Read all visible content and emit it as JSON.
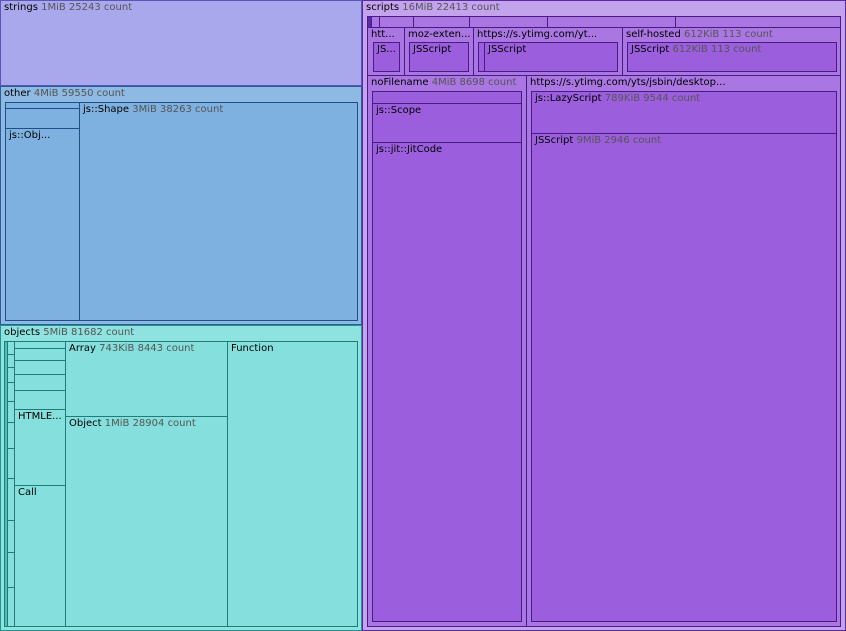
{
  "treemap": {
    "strings": {
      "name": "strings",
      "meta": "1MiB 25243 count"
    },
    "other": {
      "name": "other",
      "meta": "4MiB 59550 count",
      "children": {
        "js_obj": {
          "name": "js::Obj..."
        },
        "js_shape": {
          "name": "js::Shape",
          "meta": "3MiB 38263 count"
        }
      }
    },
    "objects": {
      "name": "objects",
      "meta": "5MiB 81682 count",
      "children": {
        "array": {
          "name": "Array",
          "meta": "743KiB 8443 count"
        },
        "object": {
          "name": "Object",
          "meta": "1MiB 28904 count"
        },
        "function": {
          "name": "Function"
        },
        "htmle": {
          "name": "HTMLE..."
        },
        "call": {
          "name": "Call"
        }
      }
    },
    "scripts": {
      "name": "scripts",
      "meta": "16MiB 22413 count",
      "children": {
        "htt": {
          "name": "htt...",
          "child": "JS..."
        },
        "moz_extension": {
          "name": "moz-exten...",
          "child": "JSScript"
        },
        "ytimg_yt": {
          "name": "https://s.ytimg.com/yt...",
          "child": "JSScript"
        },
        "self_hosted": {
          "name": "self-hosted",
          "meta": "612KiB 113 count",
          "child": "JSScript",
          "child_meta": "612KiB 113 count"
        },
        "no_filename": {
          "name": "noFilename",
          "meta": "4MiB 8698 count",
          "scope": "js::Scope",
          "jitcode": "js::jit::JitCode"
        },
        "jsbin": {
          "name": "https://s.ytimg.com/yts/jsbin/desktop...",
          "lazy_script": {
            "name": "js::LazyScript",
            "meta": "789KiB 9544 count"
          },
          "jsscript": {
            "name": "JSScript",
            "meta": "9MiB 2946 count"
          }
        }
      }
    }
  },
  "colors": {
    "strings": "#aaa8ec",
    "other": "#7fb1e0",
    "objects": "#85e0dd",
    "scripts": "#9b5fdd"
  }
}
